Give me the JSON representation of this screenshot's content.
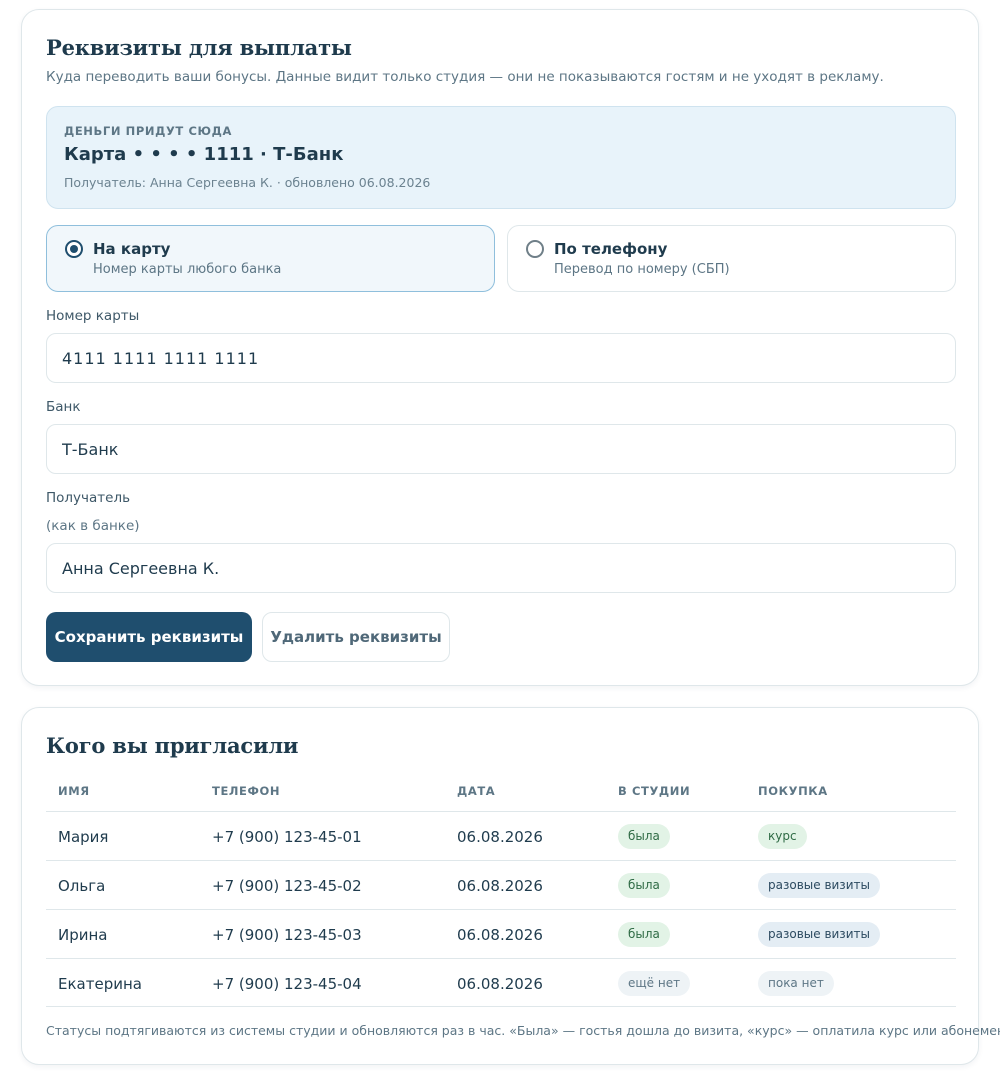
{
  "payout": {
    "title": "Реквизиты для выплаты",
    "subtitle": "Куда переводить ваши бонусы. Данные видит только студия — они не показываются гостям и не уходят в рекламу.",
    "current": {
      "caption": "ДЕНЬГИ ПРИДУТ СЮДА",
      "main": "Карта • • • • 1111 · Т-Банк",
      "meta": "Получатель: Анна Сергеевна К. · обновлено 06.08.2026"
    },
    "options": [
      {
        "label": "На карту",
        "hint": "Номер карты любого банка",
        "selected": true
      },
      {
        "label": "По телефону",
        "hint": "Перевод по номеру (СБП)",
        "selected": false
      }
    ],
    "fields": {
      "card_number": {
        "label": "Номер карты",
        "value": "4111 1111 1111 1111"
      },
      "bank": {
        "label": "Банк",
        "value": "Т-Банк"
      },
      "recipient": {
        "label": "Получатель",
        "hint": "(как в банке)",
        "value": "Анна Сергеевна К."
      }
    },
    "save_label": "Сохранить реквизиты",
    "delete_label": "Удалить реквизиты"
  },
  "invited": {
    "title": "Кого вы пригласили",
    "columns": [
      "ИМЯ",
      "ТЕЛЕФОН",
      "ДАТА",
      "В СТУДИИ",
      "ПОКУПКА"
    ],
    "rows": [
      {
        "name": "Мария",
        "phone": "+7 (900) 123-45-01",
        "date": "06.08.2026",
        "studio": "была",
        "purchase": "курс"
      },
      {
        "name": "Ольга",
        "phone": "+7 (900) 123-45-02",
        "date": "06.08.2026",
        "studio": "была",
        "purchase": "разовые визиты"
      },
      {
        "name": "Ирина",
        "phone": "+7 (900) 123-45-03",
        "date": "06.08.2026",
        "studio": "была",
        "purchase": "разовые визиты"
      },
      {
        "name": "Екатерина",
        "phone": "+7 (900) 123-45-04",
        "date": "06.08.2026",
        "studio": "ещё нет",
        "purchase": "пока нет"
      }
    ],
    "footnote": "Статусы подтягиваются из системы студии и обновляются раз в час. «Была» — гостья дошла до визита, «курс» — оплатила курс или абонемент."
  },
  "colors": {
    "accent": "#1f4e6e",
    "info_bg": "#e8f3fa",
    "status_green_bg": "#e2f3e6",
    "status_blue_bg": "#e4edf4"
  }
}
